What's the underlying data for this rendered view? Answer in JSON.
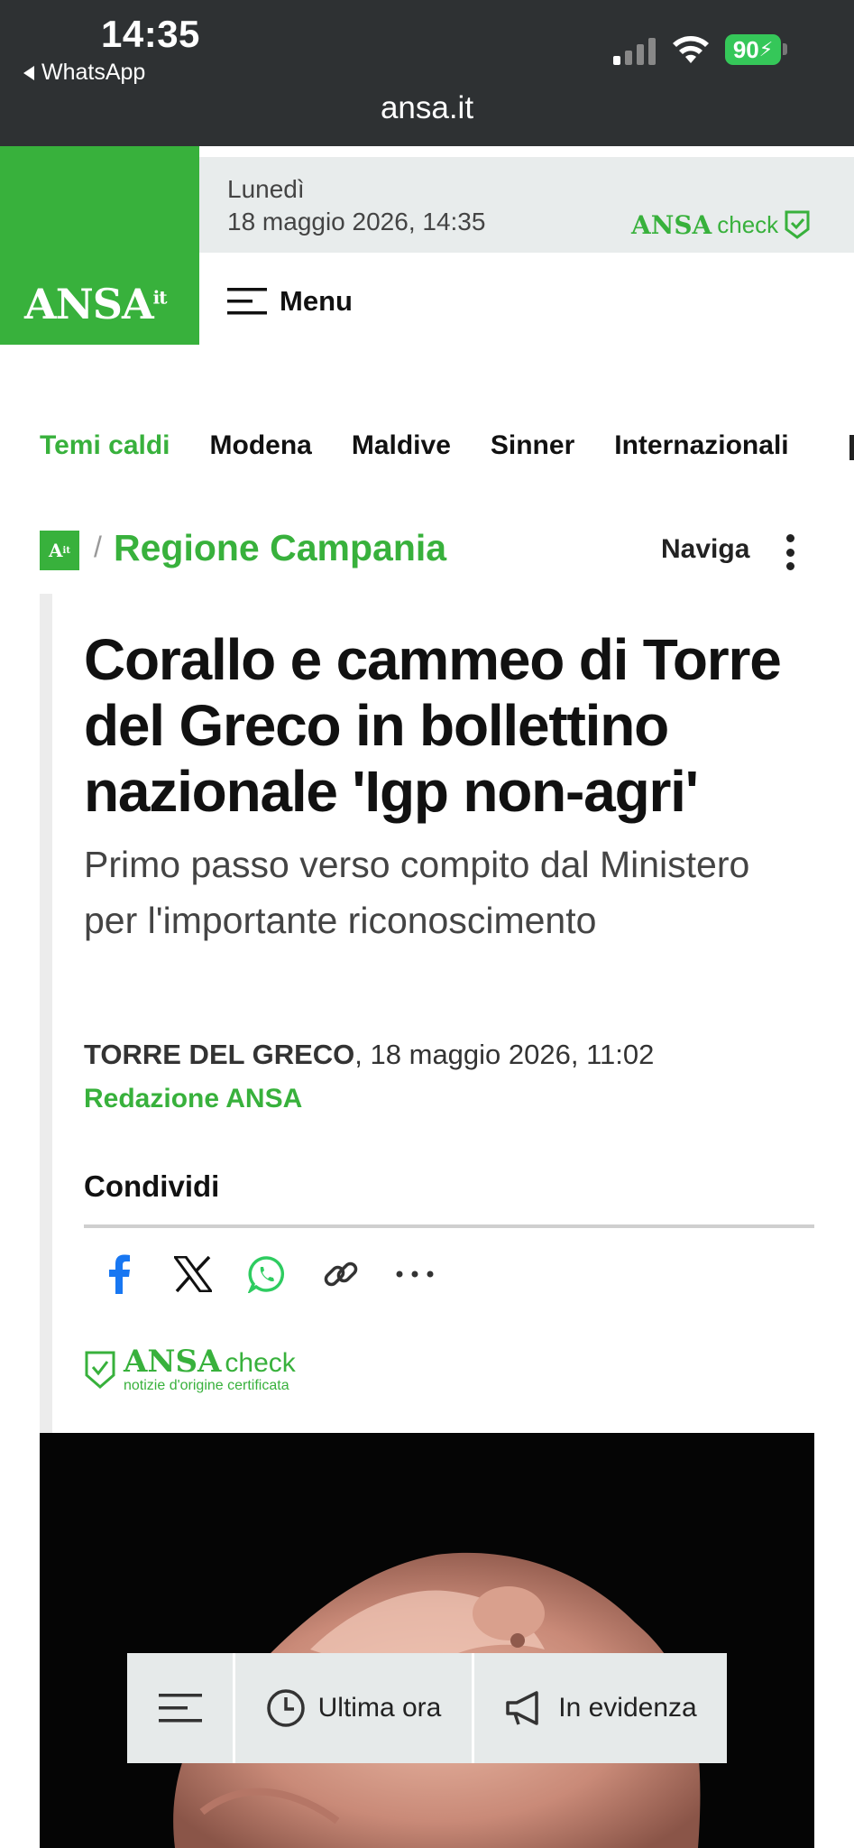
{
  "status_bar": {
    "time": "14:35",
    "back_app": "WhatsApp",
    "url": "ansa.it",
    "battery": "90"
  },
  "header": {
    "logo": "ANSA",
    "logo_suffix": "it",
    "day": "Lunedì",
    "date_time": "18 maggio 2026, 14:35",
    "check_brand": "ANSA",
    "check_word": "check",
    "menu_label": "Menu"
  },
  "topics": {
    "items": [
      "Temi caldi",
      "Modena",
      "Maldive",
      "Sinner",
      "Internazionali"
    ]
  },
  "breadcrumb": {
    "logo": "A",
    "logo_suffix": "it",
    "separator": "/",
    "section": "Regione Campania",
    "navigate_label": "Naviga"
  },
  "article": {
    "headline": "Corallo e cammeo di Torre del Greco in bollettino nazionale 'Igp non-agri'",
    "subheadline": "Primo passo verso compito dal Ministero per l'importante riconoscimento",
    "location": "TORRE DEL GRECO",
    "datetime": ", 18 maggio 2026, 11:02",
    "byline": "Redazione ANSA",
    "share_title": "Condividi",
    "check_brand": "ANSA",
    "check_word": "check",
    "check_tagline": "notizie d'origine certificata"
  },
  "bottom_bar": {
    "latest_label": "Ultima ora",
    "featured_label": "In evidenza"
  },
  "colors": {
    "brand_green": "#38b13c",
    "status_bar": "#2e3133",
    "date_band": "#e8ecec"
  }
}
